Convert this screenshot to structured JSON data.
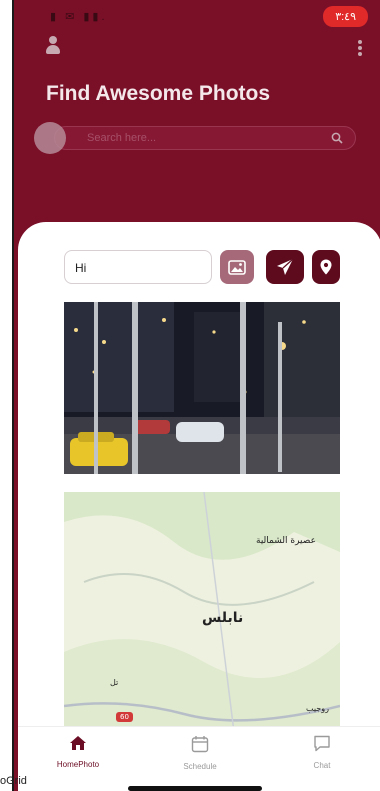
{
  "status_bar": {
    "clock": "٣:٤٩",
    "icons": "▮ ✉ ▮▮."
  },
  "header": {
    "title": "Find Awesome Photos",
    "search_placeholder": "Search here..."
  },
  "composer": {
    "message_value": "Hi"
  },
  "map": {
    "labels": {
      "town_top": "عصيرة الشمالية",
      "city": "نابلس",
      "town_left": "تل",
      "town_bottom": "روجيب",
      "road_number": "60"
    }
  },
  "nav": {
    "home_label": "HomePhoto",
    "schedule_label": "Schedule",
    "chat_label": "Chat"
  },
  "overlay": {
    "corner_text": "oGrid"
  },
  "colors": {
    "brand": "#7a0f28",
    "button_dark": "#5e0b1e",
    "button_light": "#a6697a",
    "status_red": "#e02a2a"
  }
}
